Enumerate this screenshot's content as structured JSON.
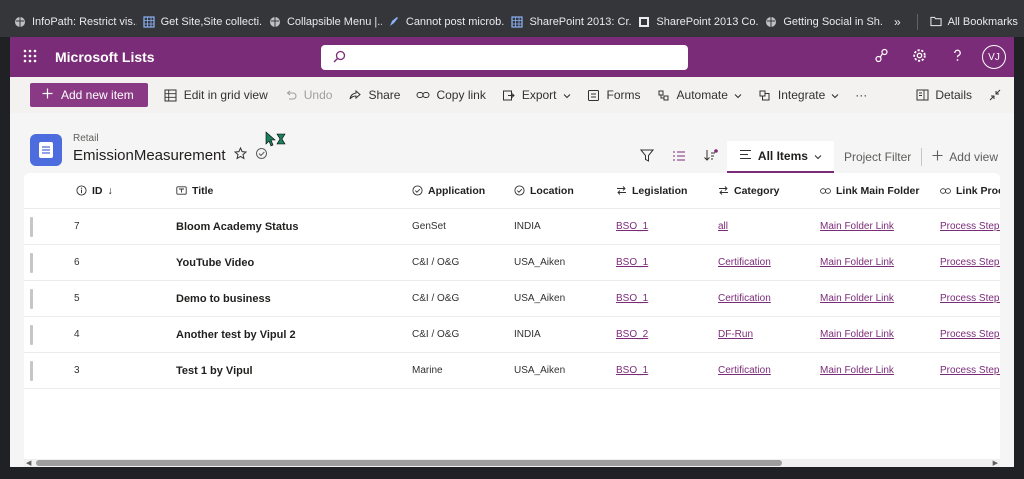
{
  "bookmarks": [
    {
      "label": "InfoPath: Restrict vis...",
      "icon": "globe-icon"
    },
    {
      "label": "Get Site,Site collecti...",
      "icon": "grid-page-icon"
    },
    {
      "label": "Collapsible Menu |...",
      "icon": "globe-icon"
    },
    {
      "label": "Cannot post microb...",
      "icon": "pen-icon"
    },
    {
      "label": "SharePoint 2013: Cr...",
      "icon": "grid-page-icon"
    },
    {
      "label": "SharePoint 2013 Co...",
      "icon": "square-icon"
    },
    {
      "label": "Getting Social in Sh...",
      "icon": "globe-icon"
    }
  ],
  "bookmarks_more": "»",
  "all_bookmarks": "All Bookmarks",
  "suite": {
    "app_name": "Microsoft Lists",
    "search_placeholder": "",
    "avatar_initials": "VJ"
  },
  "commands": {
    "new_item": "Add new item",
    "grid_view": "Edit in grid view",
    "undo": "Undo",
    "share": "Share",
    "copy_link": "Copy link",
    "export": "Export",
    "forms": "Forms",
    "automate": "Automate",
    "integrate": "Integrate",
    "more": "···",
    "details": "Details"
  },
  "list": {
    "breadcrumb": "Retail",
    "title": "EmissionMeasurement",
    "view_name": "All Items",
    "project_filter": "Project Filter",
    "add_view": "Add view"
  },
  "columns": [
    {
      "label": "ID",
      "icon": "info-icon",
      "sort": "↓"
    },
    {
      "label": "Title",
      "icon": "text-field-icon"
    },
    {
      "label": "Application",
      "icon": "choice-icon"
    },
    {
      "label": "Location",
      "icon": "choice-icon"
    },
    {
      "label": "Legislation",
      "icon": "lookup-icon"
    },
    {
      "label": "Category",
      "icon": "lookup-icon"
    },
    {
      "label": "Link Main Folder",
      "icon": "link-icon"
    },
    {
      "label": "Link Process",
      "icon": "link-icon"
    }
  ],
  "rows": [
    {
      "id": "7",
      "title": "Bloom Academy Status",
      "application": "GenSet",
      "location": "INDIA",
      "legislation": "BSO_1",
      "category": "all",
      "main_folder": "Main Folder Link",
      "process": "Process Steps L"
    },
    {
      "id": "6",
      "title": "YouTube Video",
      "application": "C&I / O&G",
      "location": "USA_Aiken",
      "legislation": "BSO_1",
      "category": "Certification",
      "main_folder": "Main Folder Link",
      "process": "Process Steps L"
    },
    {
      "id": "5",
      "title": "Demo to business",
      "application": "C&I / O&G",
      "location": "USA_Aiken",
      "legislation": "BSO_1",
      "category": "Certification",
      "main_folder": "Main Folder Link",
      "process": "Process Steps L"
    },
    {
      "id": "4",
      "title": "Another test by Vipul 2",
      "application": "C&I / O&G",
      "location": "INDIA",
      "legislation": "BSO_2",
      "category": "DF-Run",
      "main_folder": "Main Folder Link",
      "process": "Process Steps L"
    },
    {
      "id": "3",
      "title": "Test 1 by Vipul",
      "application": "Marine",
      "location": "USA_Aiken",
      "legislation": "BSO_1",
      "category": "Certification",
      "main_folder": "Main Folder Link",
      "process": "Process Steps L"
    }
  ],
  "colors": {
    "suite": "#7b2c78",
    "primary_button": "#8a3a85",
    "link": "#7b2c78",
    "list_icon": "#4d6cde"
  }
}
